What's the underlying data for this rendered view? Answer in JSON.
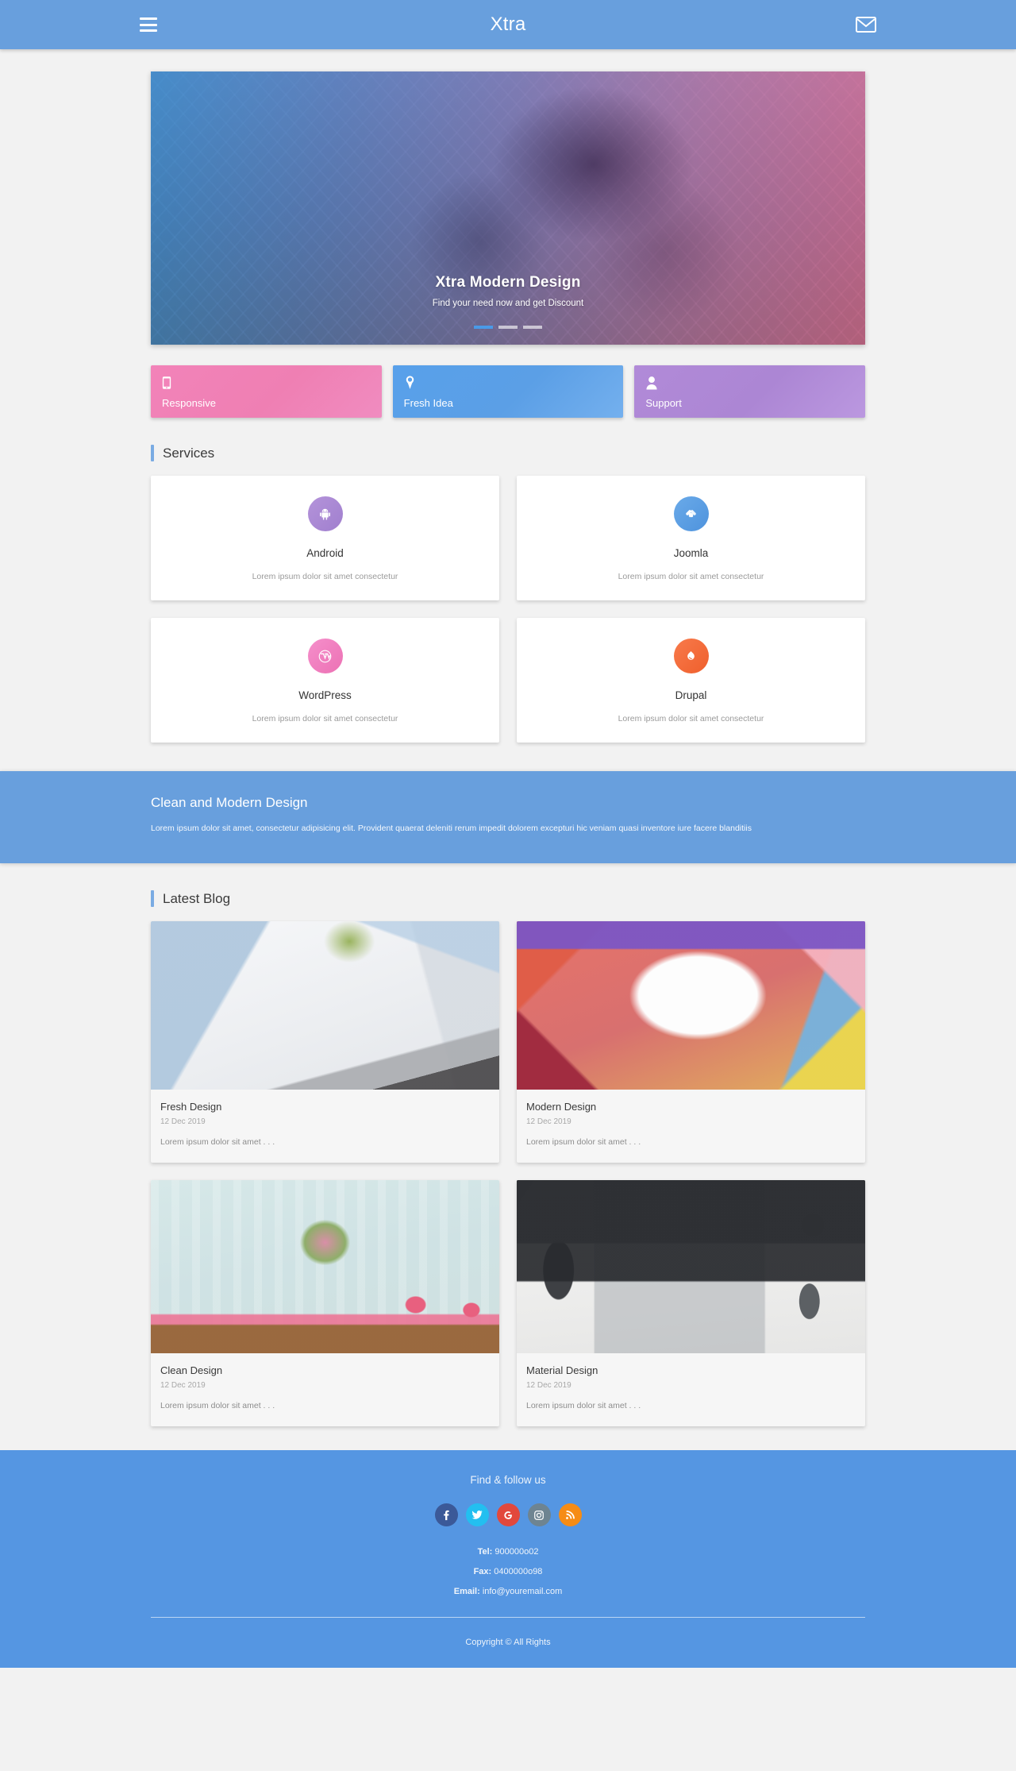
{
  "header": {
    "brand": "Xtra",
    "menu_icon": "hamburger-menu-icon",
    "mail_icon": "envelope-icon"
  },
  "hero": {
    "title": "Xtra Modern Design",
    "subtitle": "Find your need now and get Discount",
    "slides": 3,
    "active_slide": 1
  },
  "features": [
    {
      "label": "Responsive",
      "icon": "mobile-icon",
      "color": "#ef7fb3"
    },
    {
      "label": "Fresh Idea",
      "icon": "lightbulb-icon",
      "color": "#5b9fe6"
    },
    {
      "label": "Support",
      "icon": "user-icon",
      "color": "#ac86d4"
    }
  ],
  "services": {
    "heading": "Services",
    "items": [
      {
        "name": "Android",
        "desc": "Lorem ipsum dolor sit amet consectetur",
        "icon": "android-icon",
        "color": "#a987d2"
      },
      {
        "name": "Joomla",
        "desc": "Lorem ipsum dolor sit amet consectetur",
        "icon": "joomla-icon",
        "color": "#5a9de2"
      },
      {
        "name": "WordPress",
        "desc": "Lorem ipsum dolor sit amet consectetur",
        "icon": "wordpress-icon",
        "color": "#f07cc0"
      },
      {
        "name": "Drupal",
        "desc": "Lorem ipsum dolor sit amet consectetur",
        "icon": "drupal-icon",
        "color": "#f2683c"
      }
    ]
  },
  "banner": {
    "title": "Clean and Modern Design",
    "text": "Lorem ipsum dolor sit amet, consectetur adipisicing elit. Provident quaerat deleniti rerum impedit dolorem excepturi hic veniam quasi inventore iure facere blanditiis",
    "color": "#689fdd"
  },
  "blog": {
    "heading": "Latest Blog",
    "posts": [
      {
        "title": "Fresh Design",
        "date": "12 Dec 2019",
        "excerpt": "Lorem ipsum dolor sit amet . . .",
        "image": "desk-writing-laptop-photo"
      },
      {
        "title": "Modern Design",
        "date": "12 Dec 2019",
        "excerpt": "Lorem ipsum dolor sit amet . . .",
        "image": "art-supplies-photo"
      },
      {
        "title": "Clean Design",
        "date": "12 Dec 2019",
        "excerpt": "Lorem ipsum dolor sit amet . . .",
        "image": "flowers-table-photo"
      },
      {
        "title": "Material Design",
        "date": "12 Dec 2019",
        "excerpt": "Lorem ipsum dolor sit amet . . .",
        "image": "hands-laptop-desk-photo"
      }
    ]
  },
  "footer": {
    "follow_title": "Find & follow us",
    "socials": [
      {
        "name": "facebook-icon",
        "glyph": "f",
        "color": "#3b5998"
      },
      {
        "name": "twitter-icon",
        "glyph": "t",
        "color": "#23bff0"
      },
      {
        "name": "google-icon",
        "glyph": "G",
        "color": "#e2483c"
      },
      {
        "name": "instagram-icon",
        "glyph": "o",
        "color": "#6e8491"
      },
      {
        "name": "rss-icon",
        "glyph": "r",
        "color": "#f68c15"
      }
    ],
    "tel_label": "Tel:",
    "tel_value": "900000o02",
    "fax_label": "Fax:",
    "fax_value": "0400000o98",
    "email_label": "Email:",
    "email_value": "info@youremail.com",
    "copyright": "Copyright © All Rights",
    "color": "#5596e2"
  }
}
